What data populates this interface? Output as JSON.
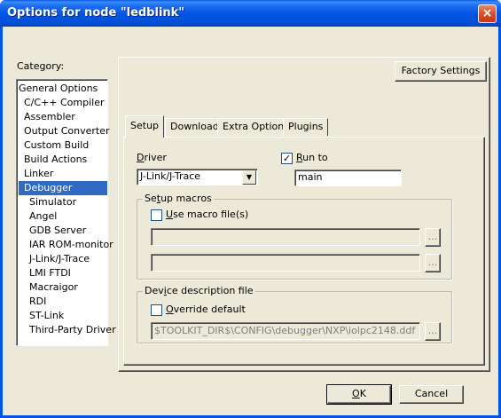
{
  "window": {
    "title": "Options for node \"ledblink\"",
    "close_icon": "×"
  },
  "category": {
    "label": "Category:",
    "items": [
      "General Options",
      "C/C++ Compiler",
      "Assembler",
      "Output Converter",
      "Custom Build",
      "Build Actions",
      "Linker",
      "Debugger",
      "Simulator",
      "Angel",
      "GDB Server",
      "IAR ROM-monitor",
      "J-Link/J-Trace",
      "LMI FTDI",
      "Macraigor",
      "RDI",
      "ST-Link",
      "Third-Party Driver"
    ],
    "selected": "Debugger"
  },
  "factory_settings_label": "Factory Settings",
  "tabs": [
    "Setup",
    "Download",
    "Extra Options",
    "Plugins"
  ],
  "active_tab": "Setup",
  "setup": {
    "driver_label": "Driver",
    "driver_value": "J-Link/J-Trace",
    "run_to_label": "Run to",
    "run_to_checked": true,
    "run_to_value": "main",
    "setup_macros_title": "Setup macros",
    "use_macro_label": "Use macro file(s)",
    "use_macro_checked": false,
    "macro_file_1": "",
    "macro_file_2": "",
    "browse_label": "...",
    "device_desc_title": "Device description file",
    "override_label": "Override default",
    "override_checked": false,
    "device_desc_value": "$TOOLKIT_DIR$\\CONFIG\\debugger\\NXP\\iolpc2148.ddf"
  },
  "buttons": {
    "ok": "OK",
    "cancel": "Cancel"
  },
  "icons": {
    "check_mark": "✓",
    "dropdown_arrow": "▼"
  }
}
